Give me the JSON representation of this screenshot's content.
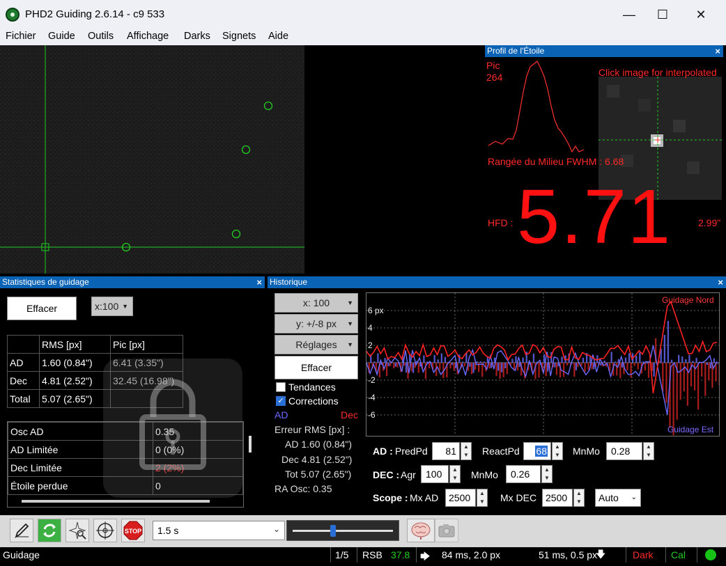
{
  "window": {
    "title": "PHD2 Guiding 2.6.14 - c9 533",
    "minimize": "—",
    "maximize": "☐",
    "close": "✕"
  },
  "menu": [
    "Fichier",
    "Guide",
    "Outils",
    "Affichage",
    "Darks",
    "Signets",
    "Aide"
  ],
  "profile": {
    "title": "Profil de l'Étoile",
    "close": "×",
    "peak_label": "Pic",
    "peak_value": "264",
    "click_hint": "Click image for interpolated",
    "midrow_label": "Rangée du Milieu FWHM : 6.68",
    "hfd_label": "HFD :",
    "hfd_value": "5.71",
    "hfd_arcsec": "2.99\""
  },
  "stats": {
    "title": "Statistiques de guidage",
    "close": "×",
    "clear_button": "Effacer",
    "scale_select": "x:100",
    "headers": [
      "",
      "RMS [px]",
      "Pic [px]"
    ],
    "rows": [
      [
        "AD",
        "1.60 (0.84\")",
        "6.41 (3.35\")"
      ],
      [
        "Dec",
        "4.81 (2.52\")",
        "32.45 (16.98\")"
      ],
      [
        "Total",
        "5.07 (2.65\")",
        ""
      ]
    ],
    "rows2": [
      [
        "Osc AD",
        "0.35"
      ],
      [
        "AD Limitée",
        "0 (0%)"
      ],
      [
        "Dec Limitée",
        "2 (2%)"
      ],
      [
        "Étoile perdue",
        "0"
      ]
    ]
  },
  "history": {
    "title": "Historique",
    "close": "×",
    "x_select": "x: 100",
    "y_select": "y: +/-8 px",
    "settings_select": "Réglages",
    "clear_button": "Effacer",
    "trends_label": "Tendances",
    "trends_checked": false,
    "corrections_label": "Corrections",
    "corrections_checked": true,
    "ra_legend": "AD",
    "dec_legend": "Dec",
    "rms_title": "Erreur RMS [px] :",
    "rms_ra": "AD 1.60 (0.84\")",
    "rms_dec": "Dec 4.81 (2.52\")",
    "rms_tot": "Tot 5.07 (2.65\")",
    "ra_osc": "RA Osc: 0.35",
    "graph_north": "Guidage Nord",
    "graph_east": "Guidage Est",
    "y_ticks": [
      "6 px",
      "4",
      "2",
      "",
      "-2",
      "-4",
      "-6"
    ],
    "ra_algo_label": "AD :",
    "predpd_label": "PredPd",
    "predpd_value": "81",
    "reactpd_label": "ReactPd",
    "reactpd_value": "68",
    "mnmo_label": "MnMo",
    "mnmo_value": "0.28",
    "dec_algo_label": "DEC :",
    "agr_label": "Agr",
    "agr_value": "100",
    "dec_mnmo_label": "MnMo",
    "dec_mnmo_value": "0.26",
    "scope_label": "Scope :",
    "mxad_label": "Mx AD",
    "mxad_value": "2500",
    "mxdec_label": "Mx DEC",
    "mxdec_value": "2500",
    "mode_select": "Auto"
  },
  "toolbar": {
    "exposure_select": "1.5 s",
    "gamma_slider": 0.4
  },
  "status": {
    "state": "Guidage",
    "page": "1/5",
    "snr_label": "RSB",
    "snr_value": "37.8",
    "ra_pulse": "84 ms, 2.0 px",
    "dec_pulse": "51 ms, 0.5 px",
    "dark": "Dark",
    "cal": "Cal"
  },
  "colors": {
    "ra": "#6a6aff",
    "dec": "#ff2a2a",
    "header_blue": "#0b63b5",
    "crosshair": "#22cc22",
    "snr_green": "#22cc22",
    "led_green": "#17c217"
  }
}
